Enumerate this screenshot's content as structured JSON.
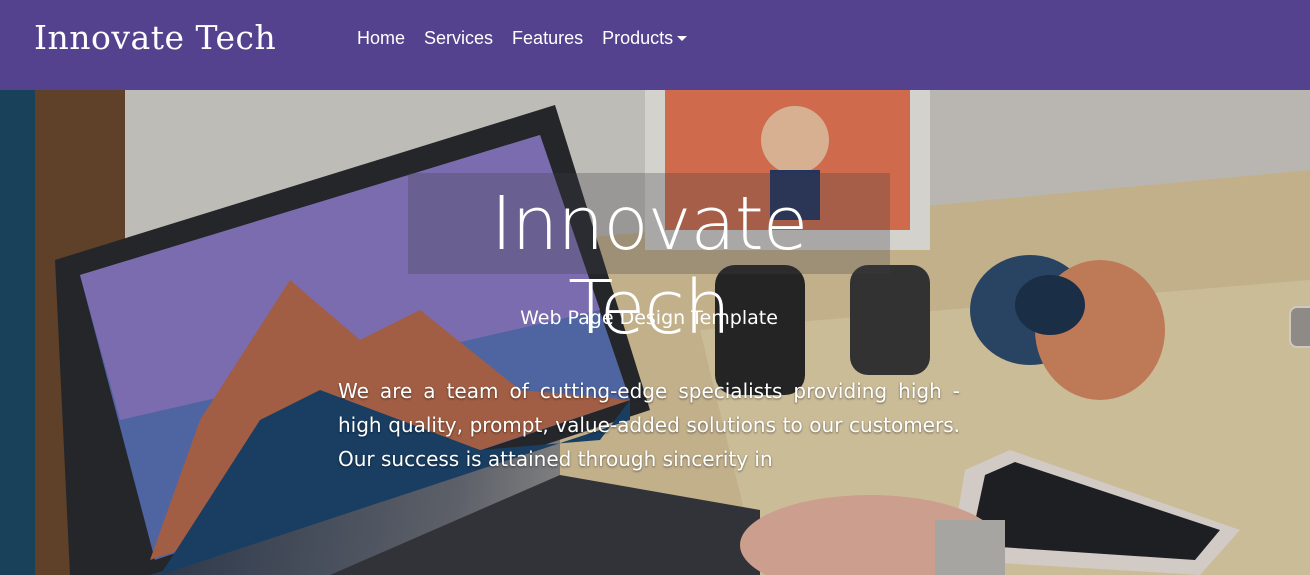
{
  "navbar": {
    "brand": "Innovate Tech",
    "links": [
      {
        "label": "Home"
      },
      {
        "label": "Services"
      },
      {
        "label": "Features"
      },
      {
        "label": "Products"
      }
    ]
  },
  "hero": {
    "title": "Innovate Tech",
    "subtitle": "Web Page Design Template",
    "description": "We are a team of cutting-edge specialists providing high - high quality, prompt, value-added solutions to our customers. Our success is attained through sincerity in"
  },
  "colors": {
    "navbar": "#54428e",
    "text": "#ffffff"
  },
  "icons": {
    "products_dropdown": "caret-down-icon",
    "side_widget": "layers-icon"
  }
}
